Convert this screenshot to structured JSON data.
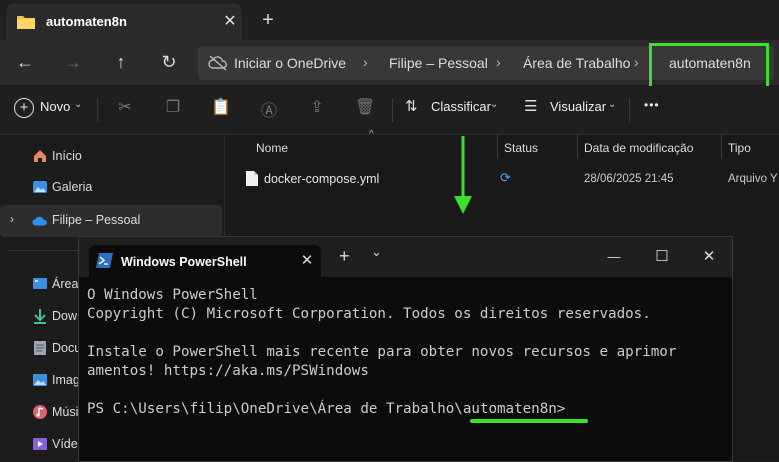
{
  "explorer": {
    "tab_title": "automaten8n",
    "tab_close": "✕",
    "new_tab": "+",
    "nav": {
      "back": "←",
      "forward": "→",
      "up": "↑",
      "refresh": "↻"
    },
    "breadcrumbs": [
      "Iniciar o OneDrive",
      "Filipe – Pessoal",
      "Área de Trabalho",
      "automaten8n"
    ],
    "breadcrumb_sep": "›",
    "toolbar": {
      "new_label": "Novo",
      "sort_label": "Classificar",
      "view_label": "Visualizar",
      "more": "•••"
    },
    "sidebar": [
      {
        "label": "Início",
        "icon": "home-icon"
      },
      {
        "label": "Galeria",
        "icon": "gallery-icon"
      },
      {
        "label": "Filipe – Pessoal",
        "icon": "onedrive-cloud-icon"
      },
      {
        "label": "Área",
        "icon": "desktop-icon"
      },
      {
        "label": "Dow",
        "icon": "download-icon"
      },
      {
        "label": "Docu",
        "icon": "document-icon"
      },
      {
        "label": "Imag",
        "icon": "image-icon"
      },
      {
        "label": "Músi",
        "icon": "music-icon"
      },
      {
        "label": "Víde",
        "icon": "video-icon"
      }
    ],
    "columns": [
      "Nome",
      "Status",
      "Data de modificação",
      "Tipo"
    ],
    "files": [
      {
        "name": "docker-compose.yml",
        "status_icon": "sync-icon",
        "modified": "28/06/2025 21:45",
        "type": "Arquivo Y"
      }
    ]
  },
  "powershell": {
    "tab_title": "Windows PowerShell",
    "tab_close": "✕",
    "new_tab": "+",
    "dropdown": "⌄",
    "controls": {
      "minimize": "—",
      "maximize": "☐",
      "close": "✕"
    },
    "lines": [
      "O Windows PowerShell",
      "Copyright (C) Microsoft Corporation. Todos os direitos reservados.",
      "",
      "Instale o PowerShell mais recente para obter novos recursos e aprimor",
      "amentos! https://aka.ms/PSWindows",
      "",
      "PS C:\\Users\\filip\\OneDrive\\Área de Trabalho\\automaten8n>"
    ]
  },
  "colors": {
    "highlight_green": "#3ce02c",
    "accent_blue": "#4aa3f5"
  }
}
